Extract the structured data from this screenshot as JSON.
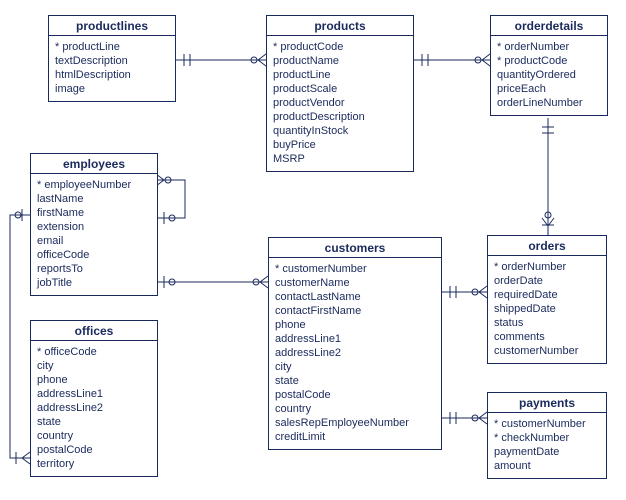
{
  "entities": {
    "productlines": {
      "title": "productlines",
      "fields": [
        "* productLine",
        "textDescription",
        "htmlDescription",
        "image"
      ]
    },
    "products": {
      "title": "products",
      "fields": [
        "* productCode",
        "productName",
        "productLine",
        "productScale",
        "productVendor",
        "productDescription",
        "quantityInStock",
        "buyPrice",
        "MSRP"
      ]
    },
    "orderdetails": {
      "title": "orderdetails",
      "fields": [
        "* orderNumber",
        "* productCode",
        "quantityOrdered",
        "priceEach",
        "orderLineNumber"
      ]
    },
    "employees": {
      "title": "employees",
      "fields": [
        "* employeeNumber",
        "lastName",
        "firstName",
        "extension",
        "email",
        "officeCode",
        "reportsTo",
        "jobTitle"
      ]
    },
    "customers": {
      "title": "customers",
      "fields": [
        "* customerNumber",
        "customerName",
        "contactLastName",
        "contactFirstName",
        "phone",
        "addressLine1",
        "addressLine2",
        "city",
        "state",
        "postalCode",
        "country",
        "salesRepEmployeeNumber",
        "creditLimit"
      ]
    },
    "orders": {
      "title": "orders",
      "fields": [
        "* orderNumber",
        "orderDate",
        "requiredDate",
        "shippedDate",
        "status",
        "comments",
        "customerNumber"
      ]
    },
    "offices": {
      "title": "offices",
      "fields": [
        "* officeCode",
        "city",
        "phone",
        "addressLine1",
        "addressLine2",
        "state",
        "country",
        "postalCode",
        "territory"
      ]
    },
    "payments": {
      "title": "payments",
      "fields": [
        "* customerNumber",
        "* checkNumber",
        "paymentDate",
        "amount"
      ]
    }
  }
}
